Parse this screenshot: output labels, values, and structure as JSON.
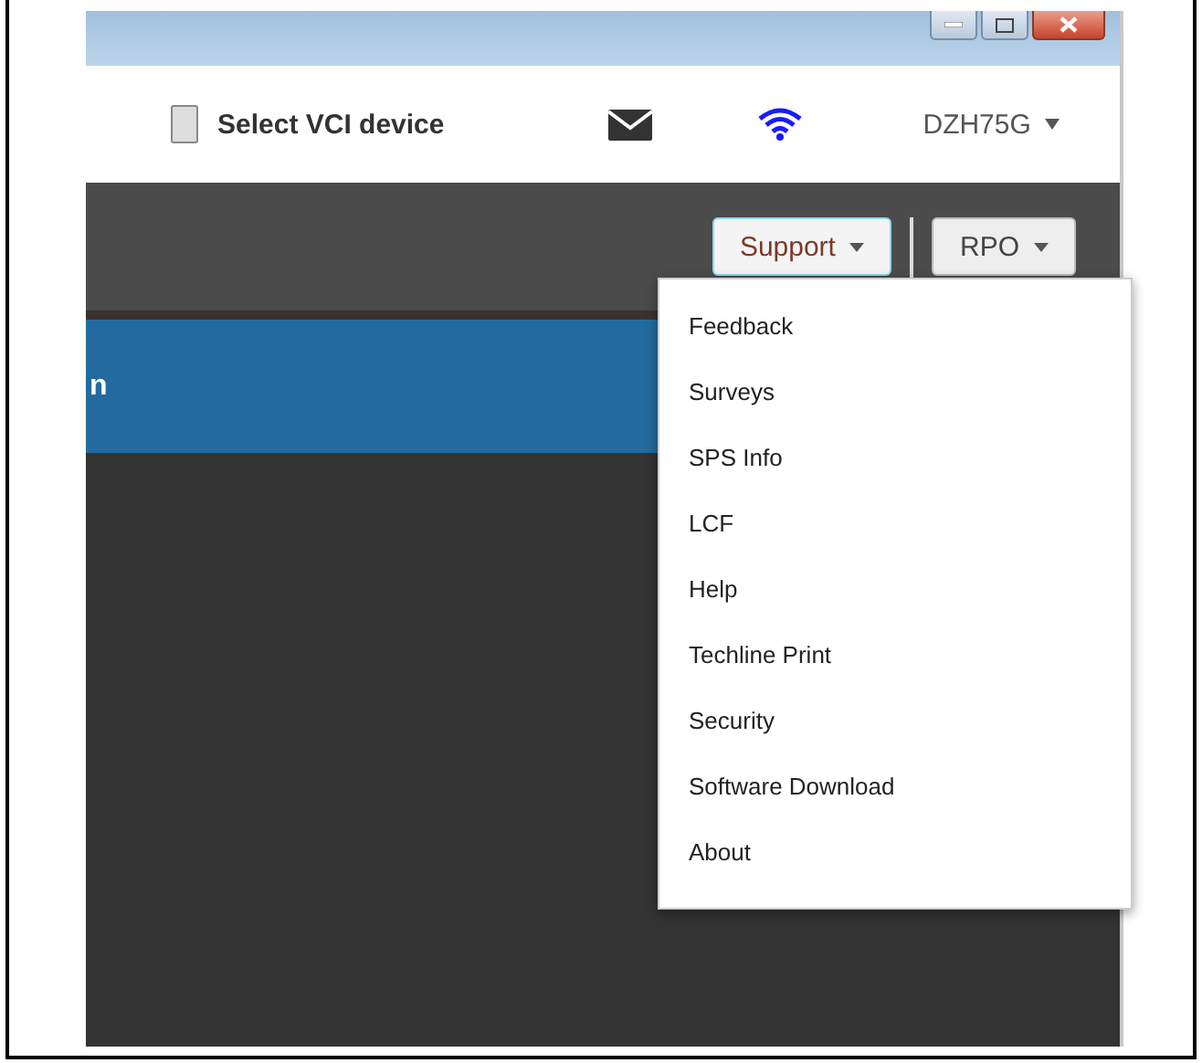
{
  "header": {
    "device_label": "Select VCI device",
    "user": "DZH75G"
  },
  "nav_buttons": [
    {
      "label": "Support",
      "selected": true
    },
    {
      "label": "RPO",
      "selected": false
    }
  ],
  "banner": {
    "text": "n"
  },
  "support_menu": {
    "expanded": true,
    "items": [
      "Feedback",
      "Surveys",
      "SPS Info",
      "LCF",
      "Help",
      "Techline Print",
      "Security",
      "Software Download",
      "About"
    ]
  }
}
